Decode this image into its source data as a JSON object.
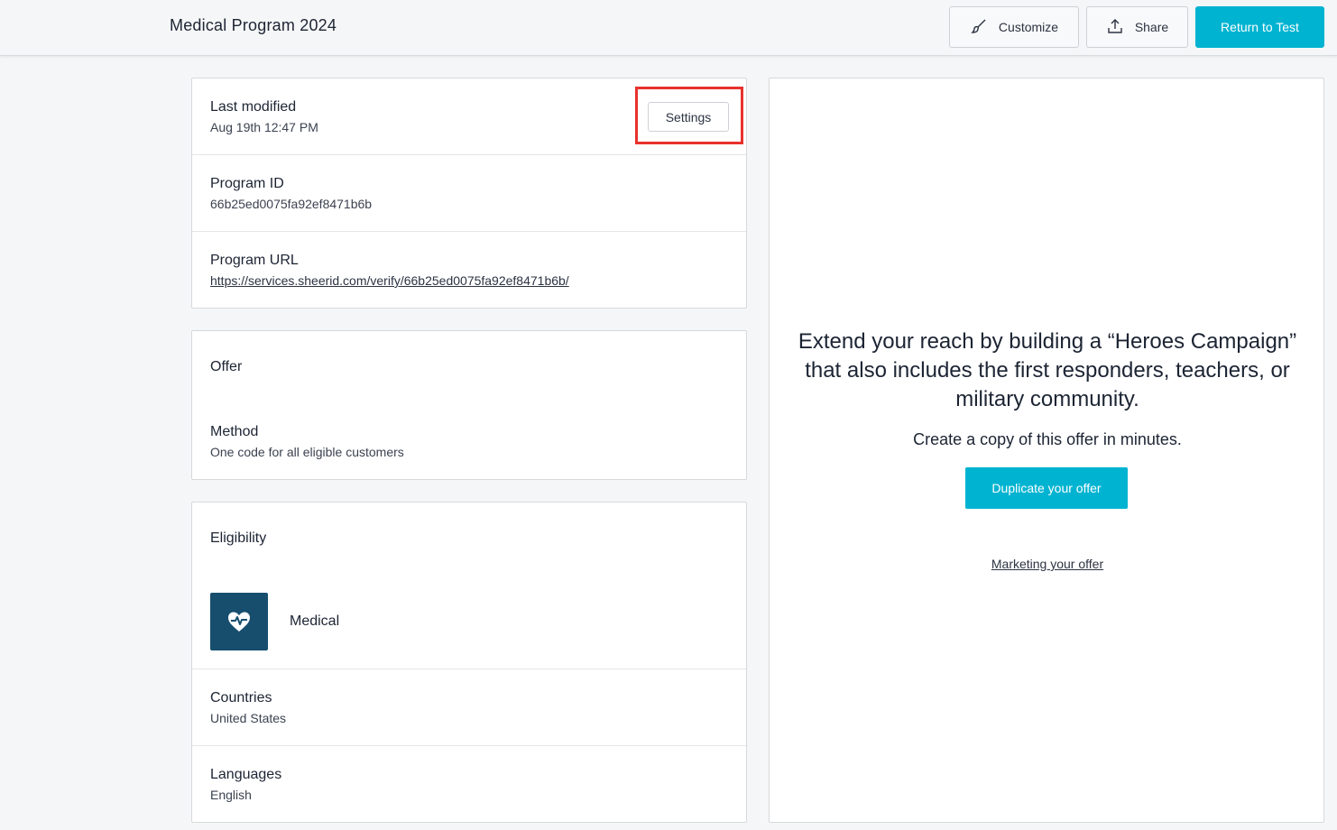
{
  "header": {
    "title": "Medical Program 2024",
    "customize_label": "Customize",
    "share_label": "Share",
    "return_label": "Return to Test"
  },
  "info_card": {
    "last_modified_label": "Last modified",
    "last_modified_value": "Aug 19th 12:47 PM",
    "settings_label": "Settings",
    "program_id_label": "Program ID",
    "program_id_value": "66b25ed0075fa92ef8471b6b",
    "program_url_label": "Program URL",
    "program_url_value": "https://services.sheerid.com/verify/66b25ed0075fa92ef8471b6b/"
  },
  "offer_card": {
    "title": "Offer",
    "method_label": "Method",
    "method_value": "One code for all eligible customers"
  },
  "eligibility_card": {
    "title": "Eligibility",
    "segment_icon": "heart-pulse-icon",
    "segment_label": "Medical",
    "countries_label": "Countries",
    "countries_value": "United States",
    "languages_label": "Languages",
    "languages_value": "English"
  },
  "promo": {
    "heading": "Extend your reach by building a “Heroes Campaign” that also includes the first responders, teachers, or military community.",
    "subheading": "Create a copy of this offer in minutes.",
    "duplicate_label": "Duplicate your offer",
    "marketing_label": "Marketing your offer"
  },
  "colors": {
    "accent": "#00b3d1",
    "segment_icon_bg": "#174e6e",
    "highlight": "#e8312c"
  }
}
